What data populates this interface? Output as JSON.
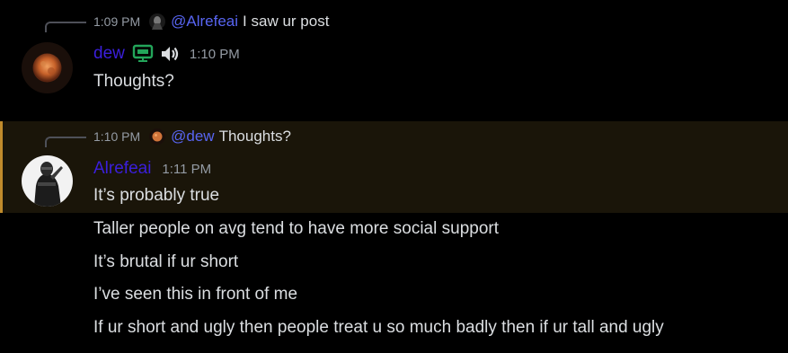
{
  "messages": [
    {
      "reply": {
        "time": "1:09 PM",
        "mention": "@Alrefeai",
        "text": "I saw ur post"
      },
      "author": {
        "name": "dew",
        "icons": [
          "monitor-icon",
          "speaker-icon"
        ],
        "name_color": "#3b1fdc"
      },
      "timestamp": "1:10 PM",
      "lines": [
        "Thoughts?"
      ]
    },
    {
      "highlighted": true,
      "reply": {
        "time": "1:10 PM",
        "mention": "@dew",
        "text": "Thoughts?"
      },
      "author": {
        "name": "Alrefeai",
        "name_color": "#3b1fdc"
      },
      "timestamp": "1:11 PM",
      "lines": [
        "It’s probably true",
        "Taller people on avg tend to have more social support",
        "It’s brutal if ur short",
        "I’ve seen this in front of me",
        "If ur short and ugly then people treat u so much badly then if ur tall and ugly"
      ]
    }
  ],
  "colors": {
    "background": "#000000",
    "mention": "#5865f2",
    "highlight_bar": "#c08b2c",
    "monitor_icon": "#23a55a"
  }
}
